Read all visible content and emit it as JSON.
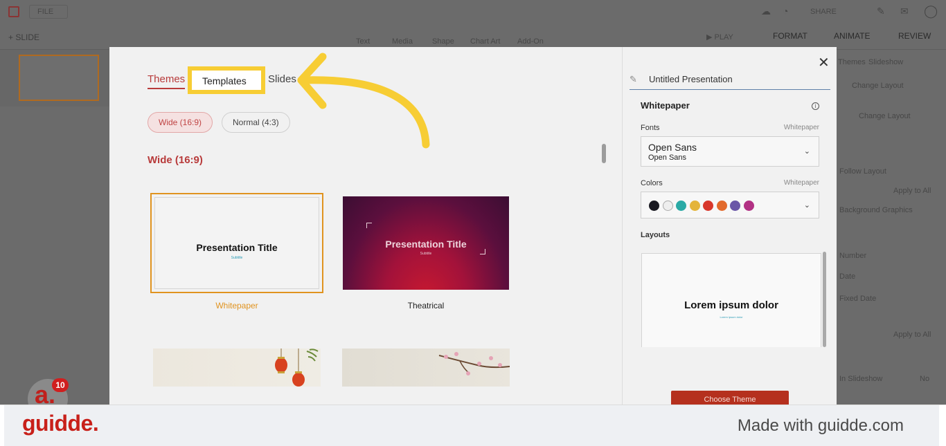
{
  "background": {
    "file_menu": "FILE",
    "slide_button": "SLIDE",
    "toolbar": [
      "Text",
      "Media",
      "Shape",
      "Chart Art",
      "Add-On"
    ],
    "play": "PLAY",
    "share": "SHARE",
    "right_tabs": [
      "FORMAT",
      "ANIMATE",
      "REVIEW"
    ],
    "right_subtabs": [
      "Themes",
      "Slideshow"
    ],
    "right_items": [
      "Change Layout",
      "Change Layout",
      "Follow Layout",
      "Apply to All",
      "Background Graphics",
      "Number",
      "Date",
      "Fixed Date",
      "Apply to All",
      "In Slideshow",
      "No"
    ]
  },
  "modal": {
    "tabs": {
      "themes": "Themes",
      "templates": "Templates",
      "slides": "Slides"
    },
    "ratio_options": {
      "wide": "Wide (16:9)",
      "normal": "Normal (4:3)"
    },
    "section_title": "Wide (16:9)",
    "themes": [
      {
        "name": "Whitepaper",
        "title": "Presentation Title",
        "subtitle": "Subtitle",
        "selected": true
      },
      {
        "name": "Theatrical",
        "title": "Presentation Title",
        "subtitle": "Subtitle",
        "selected": false
      }
    ],
    "panel": {
      "presentation_name": "Untitled Presentation",
      "theme_name": "Whitepaper",
      "fonts_label": "Fonts",
      "fonts_hint": "Whitepaper",
      "font_heading": "Open Sans",
      "font_body": "Open Sans",
      "colors_label": "Colors",
      "colors_hint": "Whitepaper",
      "colors": [
        "#1a1a22",
        "#eeeeee",
        "#2aa9a5",
        "#e4b43a",
        "#d8372b",
        "#e26a2c",
        "#6a56a7",
        "#b23184"
      ],
      "layouts_label": "Layouts",
      "layout_title": "Lorem ipsum dolor",
      "layout_sub": "Lorem ipsum dolor",
      "choose_button": "Choose Theme"
    }
  },
  "overlay": {
    "badge_letter": "a.",
    "badge_count": "10",
    "footer_logo": "guidde.",
    "footer_made_with": "Made with guidde.com",
    "highlight_color": "#f7cd34"
  }
}
